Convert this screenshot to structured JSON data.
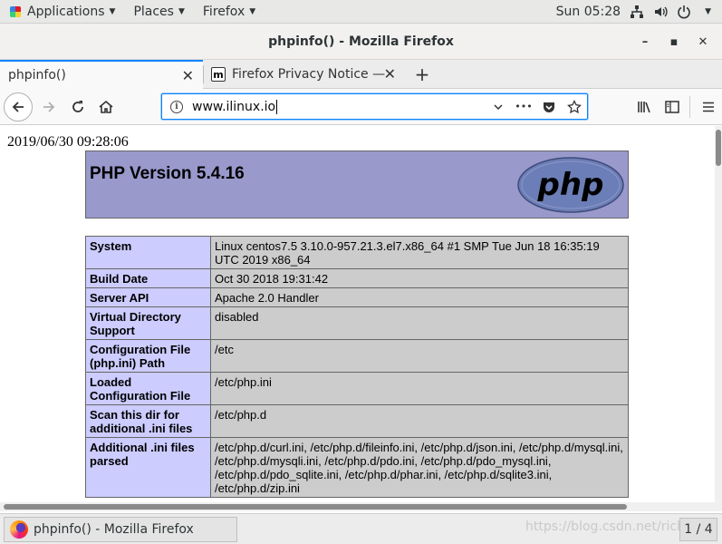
{
  "topbar": {
    "applications": "Applications",
    "places": "Places",
    "firefox": "Firefox",
    "clock": "Sun 05:28",
    "icons": [
      "network-icon",
      "volume-icon",
      "power-icon"
    ]
  },
  "window": {
    "title": "phpinfo() - Mozilla Firefox",
    "minimize": "–",
    "maximize": "▪",
    "close": "✕"
  },
  "tabs": [
    {
      "label": "phpinfo()",
      "close": "✕",
      "active": true
    },
    {
      "label": "Firefox Privacy Notice —",
      "favicon": "m",
      "close": "✕",
      "active": false
    }
  ],
  "newtab": "+",
  "navbar": {
    "url": "www.ilinux.io",
    "info": "i",
    "more": "•••"
  },
  "page": {
    "datetime": "2019/06/30 09:28:06",
    "php_version": "PHP Version 5.4.16",
    "logo_text": "php",
    "rows": [
      {
        "key": "System",
        "value": "Linux centos7.5 3.10.0-957.21.3.el7.x86_64 #1 SMP Tue Jun 18 16:35:19 UTC 2019 x86_64"
      },
      {
        "key": "Build Date",
        "value": "Oct 30 2018 19:31:42"
      },
      {
        "key": "Server API",
        "value": "Apache 2.0 Handler"
      },
      {
        "key": "Virtual Directory Support",
        "value": "disabled"
      },
      {
        "key": "Configuration File (php.ini) Path",
        "value": "/etc"
      },
      {
        "key": "Loaded Configuration File",
        "value": "/etc/php.ini"
      },
      {
        "key": "Scan this dir for additional .ini files",
        "value": "/etc/php.d"
      },
      {
        "key": "Additional .ini files parsed",
        "value": "/etc/php.d/curl.ini, /etc/php.d/fileinfo.ini, /etc/php.d/json.ini, /etc/php.d/mysql.ini, /etc/php.d/mysqli.ini, /etc/php.d/pdo.ini, /etc/php.d/pdo_mysql.ini, /etc/php.d/pdo_sqlite.ini, /etc/php.d/phar.ini, /etc/php.d/sqlite3.ini, /etc/php.d/zip.ini"
      }
    ]
  },
  "taskbar": {
    "item": "phpinfo() - Mozilla Firefox",
    "watermark": "https://blog.csdn.net/richolc",
    "pager": "1 / 4"
  },
  "colors": {
    "php_header": "#9999cc",
    "key_cell": "#ccccff",
    "value_cell": "#cccccc",
    "accent": "#0a84ff"
  }
}
